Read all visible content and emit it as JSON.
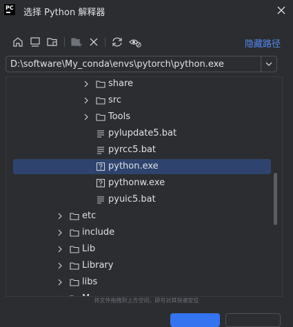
{
  "window": {
    "title": "选择 Python 解释器",
    "logo_text": "PC"
  },
  "toolbar": {
    "hide_path_label": "隐藏路径"
  },
  "path_field": {
    "value": "D:\\software\\My_conda\\envs\\pytorch\\python.exe"
  },
  "tree": {
    "items": [
      {
        "label": "share",
        "type": "folder",
        "expandable": true
      },
      {
        "label": "src",
        "type": "folder",
        "expandable": true
      },
      {
        "label": "Tools",
        "type": "folder",
        "expandable": true
      },
      {
        "label": "pylupdate5.bat",
        "type": "text-file",
        "expandable": false
      },
      {
        "label": "pyrcc5.bat",
        "type": "text-file",
        "expandable": false
      },
      {
        "label": "python.exe",
        "type": "unknown-file",
        "expandable": false,
        "selected": true
      },
      {
        "label": "pythonw.exe",
        "type": "unknown-file",
        "expandable": false
      },
      {
        "label": "pyuic5.bat",
        "type": "text-file",
        "expandable": false
      },
      {
        "label": "etc",
        "type": "folder",
        "expandable": true
      },
      {
        "label": "include",
        "type": "folder",
        "expandable": true
      },
      {
        "label": "Lib",
        "type": "folder",
        "expandable": true
      },
      {
        "label": "Library",
        "type": "folder",
        "expandable": true
      },
      {
        "label": "libs",
        "type": "folder",
        "expandable": true
      },
      {
        "label": "M",
        "type": "folder",
        "expandable": true
      }
    ]
  },
  "footer": {
    "drop_hint": "将文件拖拽到上方空间，即可对其快速定位"
  },
  "colors": {
    "background": "#2b2d30",
    "accent": "#548af7",
    "selection": "#2e436e",
    "primary_button": "#3574f0"
  }
}
